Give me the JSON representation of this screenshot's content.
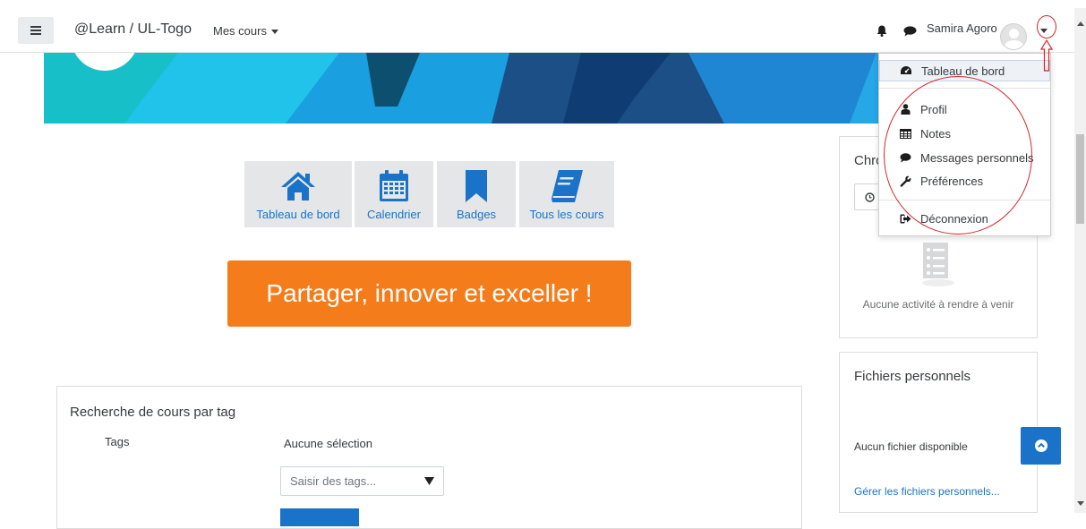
{
  "navbar": {
    "brand": "@Learn / UL-Togo",
    "courses_menu": "Mes cours",
    "user_name": "Samira Agoro"
  },
  "user_menu": {
    "items": [
      {
        "label": "Tableau de bord",
        "icon": "dashboard-icon"
      },
      {
        "label": "Profil",
        "icon": "user-icon"
      },
      {
        "label": "Notes",
        "icon": "table-icon"
      },
      {
        "label": "Messages personnels",
        "icon": "comment-icon"
      },
      {
        "label": "Préférences",
        "icon": "wrench-icon"
      },
      {
        "label": "Déconnexion",
        "icon": "sign-out-icon"
      }
    ]
  },
  "quick_links": [
    {
      "label": "Tableau de bord",
      "icon": "home-icon"
    },
    {
      "label": "Calendrier",
      "icon": "calendar-icon"
    },
    {
      "label": "Badges",
      "icon": "bookmark-icon"
    },
    {
      "label": "Tous les cours",
      "icon": "book-icon"
    }
  ],
  "slogan": "Partager, innover et exceller !",
  "tag_search": {
    "title": "Recherche de cours par tag",
    "tags_label": "Tags",
    "no_selection": "Aucune sélection",
    "placeholder": "Saisir des tags..."
  },
  "timeline_block": {
    "title_visible": "Chro",
    "empty_text": "Aucune activité à rendre à venir"
  },
  "files_block": {
    "title": "Fichiers personnels",
    "empty_text": "Aucun fichier disponible",
    "manage_link": "Gérer les fichiers personnels..."
  },
  "colors": {
    "accent": "#1a73c8",
    "slogan_bg": "#f57c1a",
    "annotation": "#d8232a"
  }
}
